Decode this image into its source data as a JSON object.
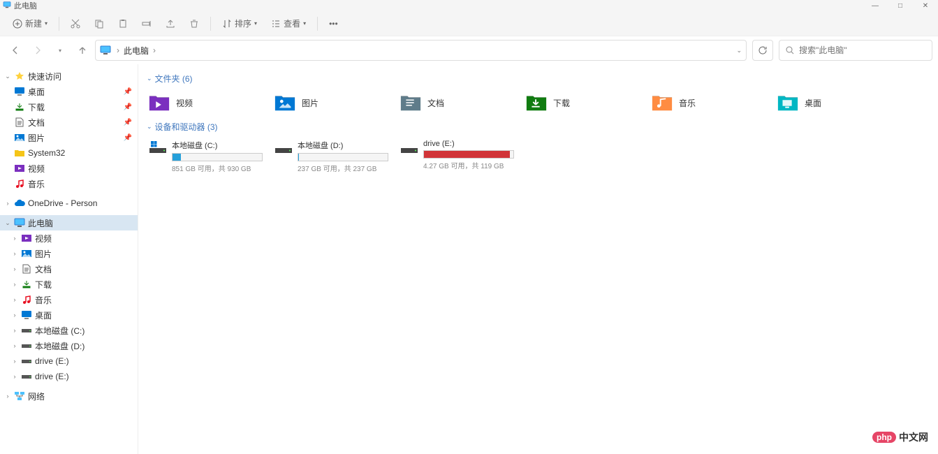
{
  "window": {
    "title": "此电脑",
    "controls": {
      "min": "—",
      "max": "□",
      "close": "✕"
    }
  },
  "toolbar": {
    "new": "新建",
    "sort": "排序",
    "view": "查看"
  },
  "nav": {
    "breadcrumb": "此电脑",
    "search_placeholder": "搜索\"此电脑\""
  },
  "sidebar": {
    "quick_access": {
      "label": "快速访问"
    },
    "quick_items": [
      {
        "label": "桌面",
        "icon": "desktop",
        "color": "#0078d4",
        "pinned": true
      },
      {
        "label": "下载",
        "icon": "download",
        "color": "#107c10",
        "pinned": true
      },
      {
        "label": "文档",
        "icon": "document",
        "color": "#666",
        "pinned": true
      },
      {
        "label": "图片",
        "icon": "picture",
        "color": "#0078d4",
        "pinned": true
      },
      {
        "label": "System32",
        "icon": "folder",
        "color": "#f5c518",
        "pinned": false
      },
      {
        "label": "视频",
        "icon": "video",
        "color": "#7b2fbf",
        "pinned": false
      },
      {
        "label": "音乐",
        "icon": "music",
        "color": "#e81123",
        "pinned": false
      }
    ],
    "onedrive": {
      "label": "OneDrive - Person"
    },
    "this_pc": {
      "label": "此电脑"
    },
    "pc_items": [
      {
        "label": "视频",
        "icon": "video",
        "color": "#7b2fbf"
      },
      {
        "label": "图片",
        "icon": "picture",
        "color": "#0078d4"
      },
      {
        "label": "文档",
        "icon": "document",
        "color": "#666"
      },
      {
        "label": "下载",
        "icon": "download",
        "color": "#107c10"
      },
      {
        "label": "音乐",
        "icon": "music",
        "color": "#e81123"
      },
      {
        "label": "桌面",
        "icon": "desktop",
        "color": "#0078d4"
      },
      {
        "label": "本地磁盘 (C:)",
        "icon": "drive",
        "color": "#888"
      },
      {
        "label": "本地磁盘 (D:)",
        "icon": "drive",
        "color": "#888"
      },
      {
        "label": "drive (E:)",
        "icon": "drive",
        "color": "#888"
      },
      {
        "label": "drive (E:)",
        "icon": "drive",
        "color": "#888"
      }
    ],
    "network": {
      "label": "网络"
    }
  },
  "content": {
    "folders_header": "文件夹 (6)",
    "folders": [
      {
        "label": "视频",
        "bg": "#7b2fbf"
      },
      {
        "label": "图片",
        "bg": "#0078d4"
      },
      {
        "label": "文档",
        "bg": "#5f7c8a"
      },
      {
        "label": "下载",
        "bg": "#107c10"
      },
      {
        "label": "音乐",
        "bg": "#ff8c42"
      },
      {
        "label": "桌面",
        "bg": "#00b7c3"
      }
    ],
    "drives_header": "设备和驱动器 (3)",
    "drives": [
      {
        "label": "本地磁盘 (C:)",
        "text": "851 GB 可用，共 930 GB",
        "fill_pct": 9,
        "fill_color": "#26a0da",
        "win_icon": true
      },
      {
        "label": "本地磁盘 (D:)",
        "text": "237 GB 可用，共 237 GB",
        "fill_pct": 1,
        "fill_color": "#26a0da",
        "win_icon": false
      },
      {
        "label": "drive (E:)",
        "text": "4.27 GB 可用，共 119 GB",
        "fill_pct": 96,
        "fill_color": "#d13438",
        "win_icon": false
      }
    ]
  },
  "watermark": {
    "badge": "php",
    "text": "中文网"
  }
}
